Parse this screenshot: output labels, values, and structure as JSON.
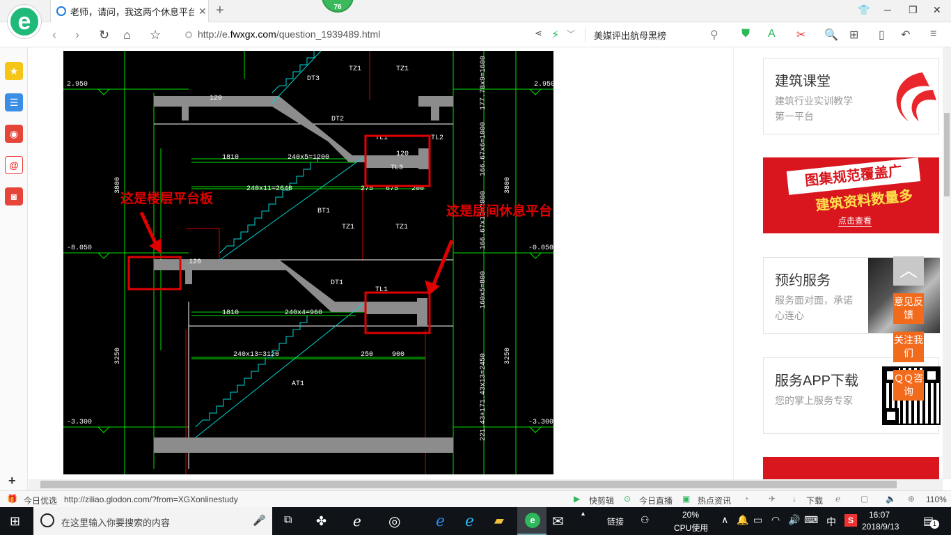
{
  "browser": {
    "tab_title": "老师，请问，我这两个休息平台都...",
    "badge": "76",
    "url_prefix": "http://e.",
    "url_domain": "fwxgx.com",
    "url_suffix": "/question_1939489.html",
    "search_text": "美媒评出航母黑榜"
  },
  "cad": {
    "annotation_left": "这是楼层平台板",
    "annotation_right": "这是层间休息平台",
    "elev_top": "2.950",
    "elev_mid_left": "-8.050",
    "elev_mid_right": "-0.050",
    "elev_bottom": "-3.300",
    "labels": {
      "dt3": "DT3",
      "dt2": "DT2",
      "dt1": "DT1",
      "bt1": "BT1",
      "at1": "AT1",
      "tz1": "TZ1",
      "tl1": "TL1",
      "tl2": "TL2",
      "tl3": "TL3",
      "w120": "120",
      "d1810": "1810",
      "d240x5": "240x5=1200",
      "d240x11": "240x11=2640",
      "d275": "275",
      "d675": "675",
      "d200": "200",
      "d240x4": "240x4=960",
      "d240x13": "240x13=3120",
      "d250": "250",
      "d900": "900",
      "h3800": "3800",
      "h3250": "3250",
      "v177": "177.78x9=1600",
      "v166a": "166.67x6=1000",
      "v166b": "166.67x12=2000",
      "v160": "160x5=800",
      "v221": "221.43+171.43x13=2450"
    }
  },
  "sidebar_cards": [
    {
      "title": "建筑课堂",
      "desc": "建筑行业实训教学第一平台"
    },
    {
      "title": "预约服务",
      "desc": "服务面对面，承诺心连心"
    },
    {
      "title": "服务APP下载",
      "desc": "您的掌上服务专家"
    }
  ],
  "banner": {
    "line1": "图集规范覆盖广",
    "line2": "建筑资料数量多",
    "btn": "点击查看"
  },
  "floats": {
    "feedback": "意见反馈",
    "follow": "关注我们",
    "qq": "ＱＱ咨询"
  },
  "statusbar": {
    "today": "今日优选",
    "link": "http://ziliao.glodon.com/?from=XGXonlinestudy",
    "kuaijianji": "快剪辑",
    "live": "今日直播",
    "news": "热点资讯",
    "download": "下载",
    "zoom": "110%"
  },
  "taskbar": {
    "search_placeholder": "在这里输入你要搜索的内容",
    "link_label": "链接",
    "cpu_pct": "20%",
    "cpu_label": "CPU使用",
    "ime": "中",
    "time": "16:07",
    "date": "2018/9/13",
    "notif": "1"
  }
}
